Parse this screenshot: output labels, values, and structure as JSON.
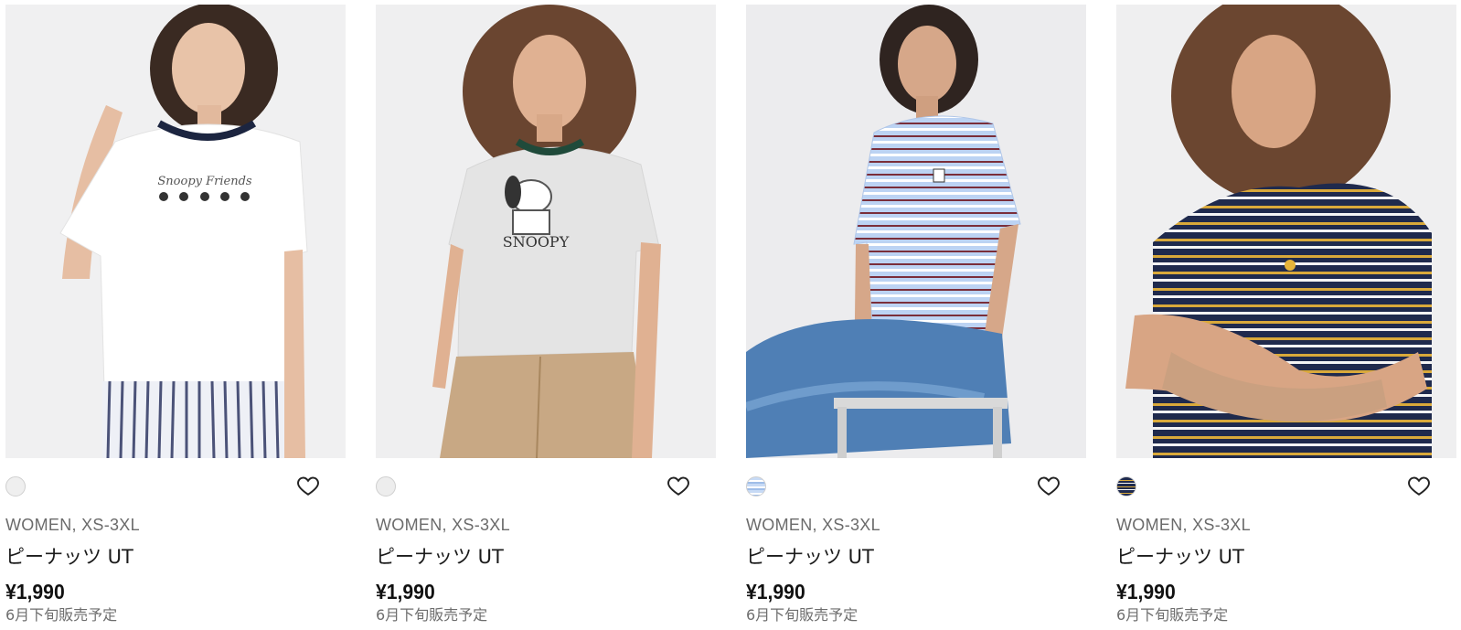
{
  "products": [
    {
      "swatch_color": "#efefef",
      "category": "WOMEN, XS-3XL",
      "name": "ピーナッツ UT",
      "price": "¥1,990",
      "note": "6月下旬販売予定",
      "tee_color": "#ffffff",
      "graphic": "snoopy-friends-print",
      "photo_text": "Snoopy Friends"
    },
    {
      "swatch_color": "#ededed",
      "category": "WOMEN, XS-3XL",
      "name": "ピーナッツ UT",
      "price": "¥1,990",
      "note": "6月下旬販売予定",
      "tee_color": "#e4e4e4",
      "graphic": "snoopy-print",
      "photo_text": "SNOOPY"
    },
    {
      "swatch_color": "#c7daf5",
      "category": "WOMEN, XS-3XL",
      "name": "ピーナッツ UT",
      "price": "¥1,990",
      "note": "6月下旬販売予定",
      "tee_color": "#bcd3f3",
      "graphic": "snoopy-embroidery"
    },
    {
      "swatch_color": "#1f2a4d",
      "category": "WOMEN, XS-3XL",
      "name": "ピーナッツ UT",
      "price": "¥1,990",
      "note": "6月下旬販売予定",
      "tee_color": "#1f2a4d",
      "graphic": "woodstock-embroidery"
    }
  ],
  "icons": {
    "favorite": "heart-outline-icon",
    "swatch": "color-chip"
  }
}
